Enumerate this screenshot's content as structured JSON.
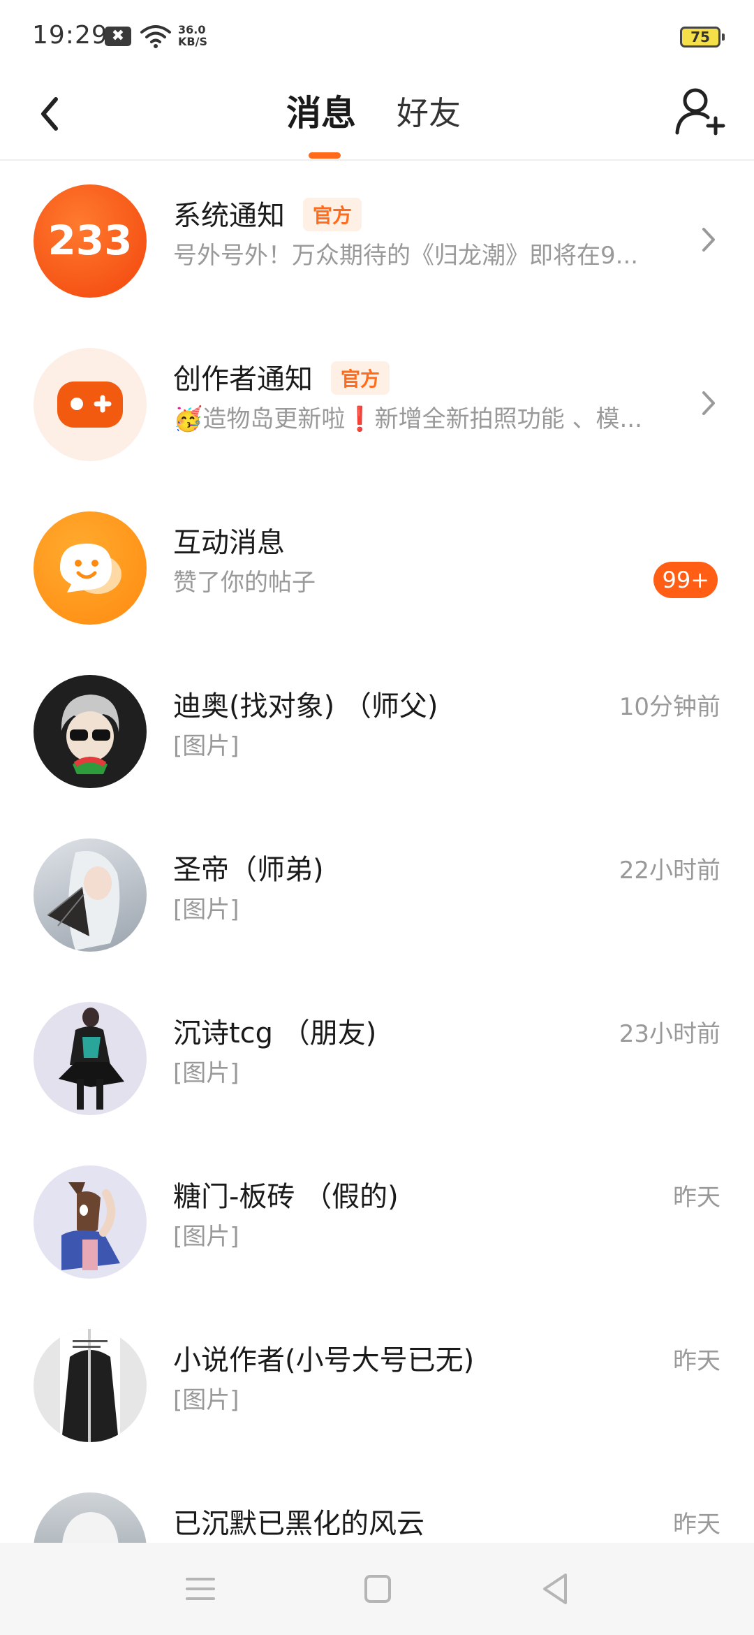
{
  "status_bar": {
    "time": "19:29",
    "notif_glyph": "✖",
    "speed_value": "36.0",
    "speed_unit": "KB/S",
    "battery": "75"
  },
  "header": {
    "tabs": [
      {
        "label": "消息",
        "active": true
      },
      {
        "label": "好友",
        "active": false
      }
    ],
    "accent_color": "#ff6b1a"
  },
  "messages": [
    {
      "title": "系统通知",
      "badge": "官方",
      "preview": "号外号外！万众期待的《归龙潮》即将在9...",
      "avatar_text": "233",
      "avatar_icon": "233-logo-icon",
      "trailing": "chevron"
    },
    {
      "title": "创作者通知",
      "badge": "官方",
      "preview": "🥳造物岛更新啦❗新增全新拍照功能 、模...",
      "avatar_icon": "gamepad-icon",
      "trailing": "chevron"
    },
    {
      "title": "互动消息",
      "preview": "赞了你的帖子",
      "avatar_icon": "chat-bubble-icon",
      "count": "99+"
    },
    {
      "title": "迪奥(找对象) （师父)",
      "preview": "[图片]",
      "time": "10分钟前"
    },
    {
      "title": "圣帝（师弟)",
      "preview": "[图片]",
      "time": "22小时前"
    },
    {
      "title": "沉诗tcg （朋友)",
      "preview": "[图片]",
      "time": "23小时前"
    },
    {
      "title": "糖门-板砖 （假的)",
      "preview": "[图片]",
      "time": "昨天"
    },
    {
      "title": "小说作者(小号大号已无)",
      "preview": "[图片]",
      "time": "昨天"
    },
    {
      "title": "已沉默已黑化的风云",
      "preview": "",
      "time": "昨天"
    }
  ],
  "nav_bar": {
    "buttons": [
      "menu-icon",
      "home-square-icon",
      "back-triangle-icon"
    ]
  }
}
